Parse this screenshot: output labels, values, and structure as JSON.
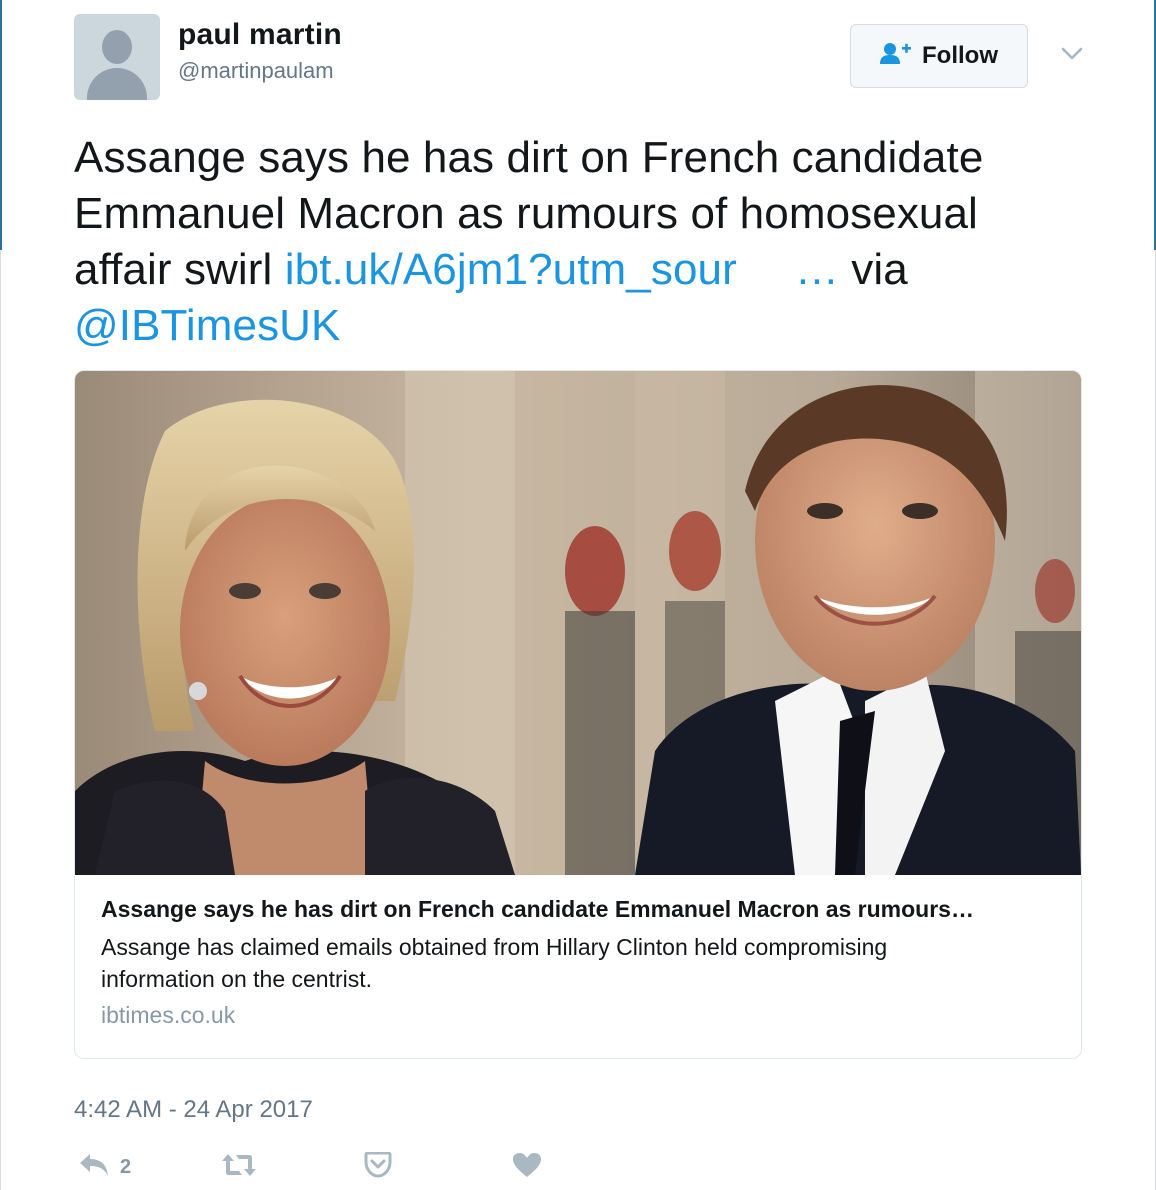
{
  "author": {
    "display_name": "paul martin",
    "handle": "@martinpaulam",
    "avatar_icon": "default-profile-icon"
  },
  "follow_button": {
    "label": "Follow",
    "icon": "follow-person-plus-icon"
  },
  "more_menu": {
    "icon": "chevron-down-icon"
  },
  "tweet": {
    "text_before": "Assange says he has dirt on French candidate Emmanuel Macron as rumours of homosexual affair swirl ",
    "link_text": "ibt.uk/A6jm1?utm_sour",
    "link_ellipsis": "…",
    "via_text": " via ",
    "mention": "@IBTimesUK"
  },
  "card": {
    "image_alt_icon": "news-photo",
    "title": "Assange says he has dirt on French candidate Emmanuel Macron as rumours…",
    "description": "Assange has claimed emails obtained from Hillary Clinton held compromising information on the centrist.",
    "domain": "ibtimes.co.uk"
  },
  "timestamp": "4:42 AM - 24 Apr 2017",
  "actions": {
    "reply_icon": "reply-icon",
    "reply_count": "2",
    "retweet_icon": "retweet-icon",
    "save_icon": "pocket-save-icon",
    "like_icon": "heart-icon"
  },
  "colors": {
    "link": "#1b95e0",
    "text": "#14171a",
    "muted": "#657786",
    "action_icon": "#aab8c2"
  }
}
